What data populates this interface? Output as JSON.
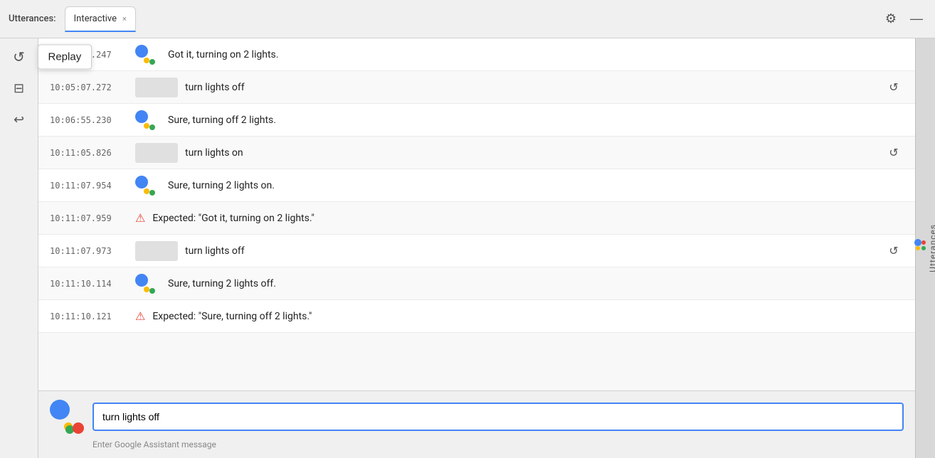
{
  "titleBar": {
    "utterances_label": "Utterances:",
    "tab_label": "Interactive",
    "tab_close": "×",
    "settings_icon": "⚙",
    "minimize_icon": "—"
  },
  "toolbar": {
    "replay_tooltip": "Replay",
    "replay_icon": "↺",
    "save_icon": "⊟",
    "undo_icon": "↩"
  },
  "utterances": [
    {
      "timestamp": "10:04:36.247",
      "type": "assistant",
      "text": "Got it, turning on 2 lights.",
      "has_dots": true
    },
    {
      "timestamp": "10:05:07.272",
      "type": "user",
      "text": "turn lights off",
      "has_replay": true
    },
    {
      "timestamp": "10:06:55.230",
      "type": "assistant",
      "text": "Sure, turning off 2 lights.",
      "has_dots": true
    },
    {
      "timestamp": "10:11:05.826",
      "type": "user",
      "text": "turn lights on",
      "has_replay": true
    },
    {
      "timestamp": "10:11:07.954",
      "type": "assistant",
      "text": "Sure, turning 2 lights on.",
      "has_dots": true
    },
    {
      "timestamp": "10:11:07.959",
      "type": "error",
      "text": "Expected: \"Got it, turning on 2 lights.\""
    },
    {
      "timestamp": "10:11:07.973",
      "type": "user",
      "text": "turn lights off",
      "has_replay": true
    },
    {
      "timestamp": "10:11:10.114",
      "type": "assistant",
      "text": "Sure, turning 2 lights off.",
      "has_dots": true
    },
    {
      "timestamp": "10:11:10.121",
      "type": "error",
      "text": "Expected: \"Sure, turning off 2 lights.\""
    }
  ],
  "input": {
    "value": "turn lights off",
    "placeholder": "Enter Google Assistant message"
  },
  "rightSidebar": {
    "label": "Utterances"
  }
}
